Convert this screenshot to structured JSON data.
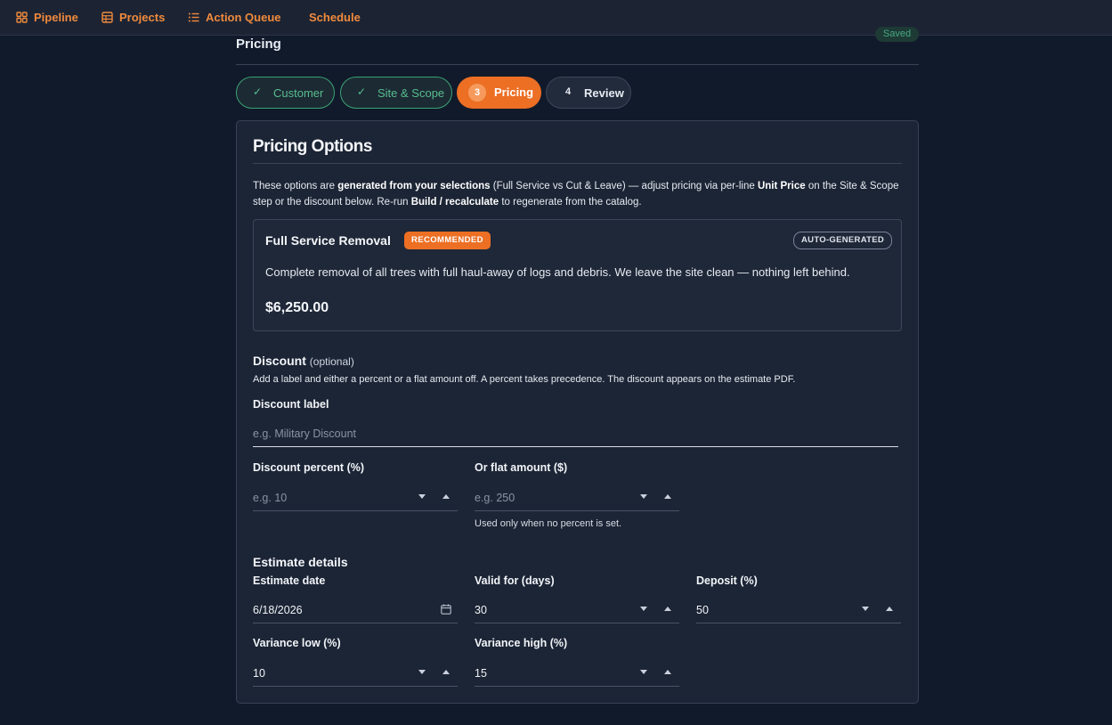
{
  "nav": {
    "items": [
      {
        "label": "Pipeline",
        "icon": "grid-icon"
      },
      {
        "label": "Projects",
        "icon": "table-icon"
      },
      {
        "label": "Action Queue",
        "icon": "list-icon"
      },
      {
        "label": "Schedule"
      }
    ],
    "accent": "#f08a3c"
  },
  "section": {
    "title": "Pricing",
    "saved_badge": "Saved"
  },
  "steps": [
    {
      "label": "Customer",
      "state": "done"
    },
    {
      "label": "Site & Scope",
      "state": "done"
    },
    {
      "number": "3",
      "label": "Pricing",
      "state": "active"
    },
    {
      "number": "4",
      "label": "Review",
      "state": "todo"
    }
  ],
  "card": {
    "title": "Pricing Options",
    "intro": {
      "p1": "These options are ",
      "b1": "generated from your selections",
      "p2": " (Full Service vs Cut & Leave) — adjust pricing via per-line ",
      "b2": "Unit Price",
      "p3": " on the Site & Scope step or the discount below. Re-run ",
      "b3": "Build / recalculate",
      "p4": " to regenerate from the catalog."
    },
    "option": {
      "name": "Full Service Removal",
      "recommended_badge": "RECOMMENDED",
      "auto_badge": "AUTO-GENERATED",
      "description": "Complete removal of all trees with full haul-away of logs and debris. We leave the site clean — nothing left behind.",
      "price": "$6,250.00"
    }
  },
  "discount": {
    "title": "Discount",
    "optional": "(optional)",
    "help": "Add a label and either a percent or a flat amount off. A percent takes precedence. The discount appears on the estimate PDF.",
    "label_field": {
      "label": "Discount label",
      "placeholder": "e.g. Military Discount"
    },
    "percent_field": {
      "label": "Discount percent (%)",
      "placeholder": "e.g. 10"
    },
    "flat_field": {
      "label": "Or flat amount ($)",
      "placeholder": "e.g. 250",
      "helper": "Used only when no percent is set."
    }
  },
  "estimate": {
    "title": "Estimate details",
    "date": {
      "label": "Estimate date",
      "value": "6/18/2026"
    },
    "valid_days": {
      "label": "Valid for (days)",
      "value": "30"
    },
    "deposit": {
      "label": "Deposit (%)",
      "value": "50"
    },
    "variance_low": {
      "label": "Variance low (%)",
      "value": "10"
    },
    "variance_high": {
      "label": "Variance high (%)",
      "value": "15"
    }
  },
  "colors": {
    "active_step": "#ec6f24",
    "done_step": "#3aa373",
    "background": "#111a2b",
    "card": "#1c2535"
  }
}
